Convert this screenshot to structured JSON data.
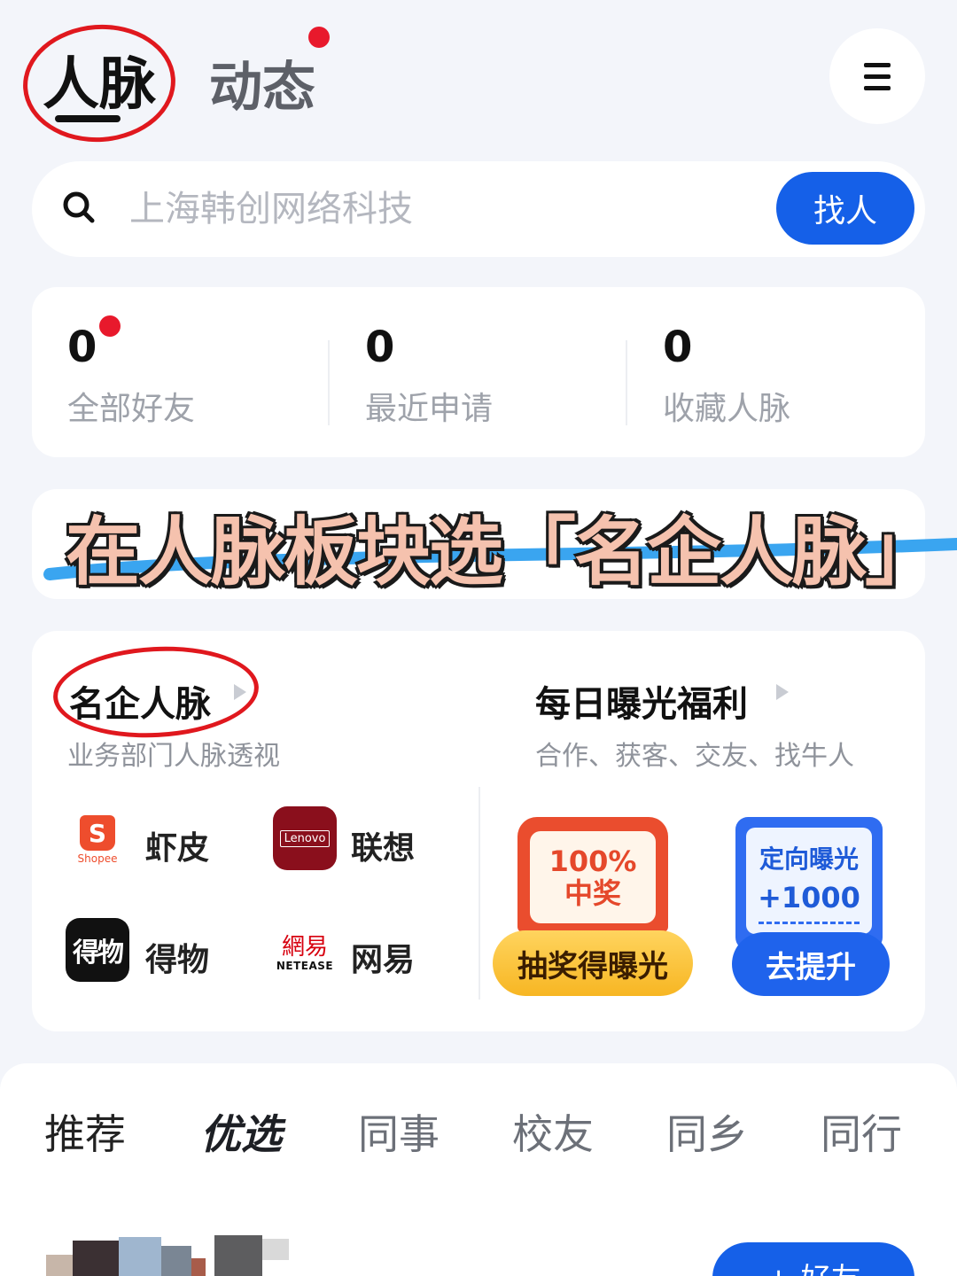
{
  "top_tabs": {
    "renmai": "人脉",
    "dongtai": "动态"
  },
  "search": {
    "placeholder": "上海韩创网络科技",
    "button": "找人"
  },
  "stats": [
    {
      "value": "0",
      "label": "全部好友"
    },
    {
      "value": "0",
      "label": "最近申请"
    },
    {
      "value": "0",
      "label": "收藏人脉"
    }
  ],
  "overlay_caption": "在人脉板块选「名企人脉」",
  "famous_companies": {
    "title": "名企人脉",
    "subtitle": "业务部门人脉透视",
    "companies": [
      {
        "name": "虾皮",
        "logo_text": "S",
        "logo_subtext": "Shopee"
      },
      {
        "name": "联想",
        "logo_text": "Lenovo"
      },
      {
        "name": "得物",
        "logo_text": "得物"
      },
      {
        "name": "网易",
        "logo_text": "網易",
        "logo_subtext": "NETEASE"
      }
    ]
  },
  "daily_exposure": {
    "title": "每日曝光福利",
    "subtitle": "合作、获客、交友、找牛人",
    "lottery": {
      "line1": "100%",
      "line2": "中奖",
      "button": "抽奖得曝光"
    },
    "targeted": {
      "line1": "定向曝光",
      "line2": "+1000",
      "button": "去提升"
    }
  },
  "category_tabs": [
    "推荐",
    "优选",
    "同事",
    "校友",
    "同乡",
    "同行"
  ],
  "bottom": {
    "add_button": "+ 好友"
  },
  "colors": {
    "accent_blue": "#1560e8",
    "notification_red": "#e8192c",
    "annotation_red": "#e0181e",
    "page_bg": "#f3f5fa"
  }
}
